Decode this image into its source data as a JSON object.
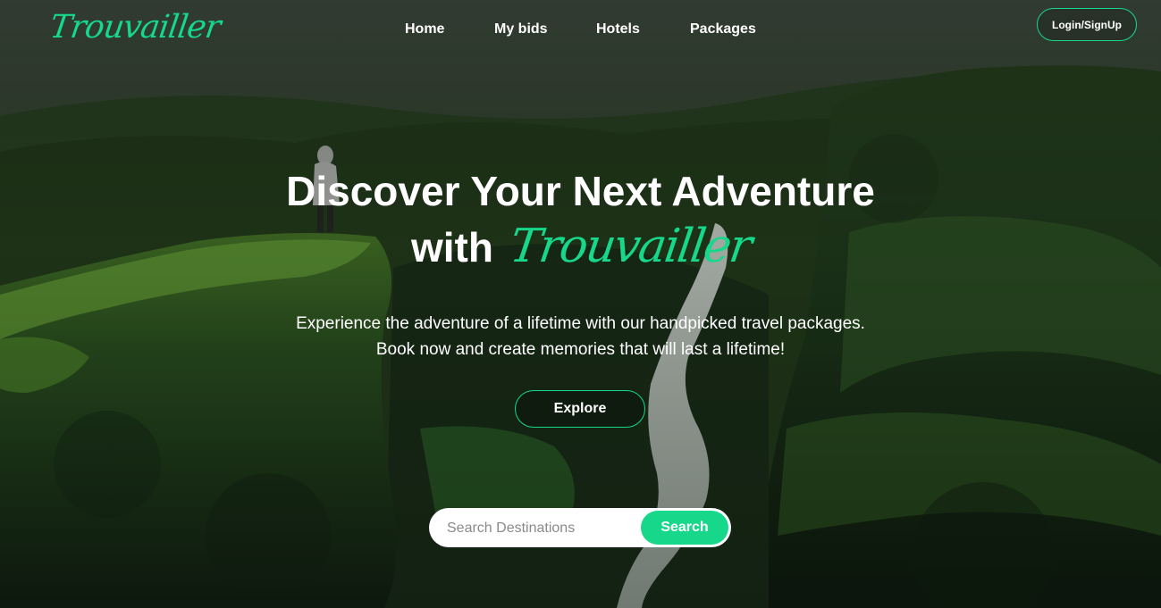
{
  "brand": {
    "logo_text": "Trouvailler",
    "accent_color": "#17d78a"
  },
  "nav": {
    "links": [
      {
        "label": "Home"
      },
      {
        "label": "My bids"
      },
      {
        "label": "Hotels"
      },
      {
        "label": "Packages"
      }
    ],
    "login_label": "Login/SignUp"
  },
  "hero": {
    "headline_line1": "Discover Your Next Adventure",
    "headline_with": "with",
    "headline_brand": "Trouvailler",
    "subtext_line1": "Experience the adventure of a lifetime with our handpicked travel packages.",
    "subtext_line2": "Book now and create memories that will last a lifetime!",
    "explore_label": "Explore"
  },
  "search": {
    "placeholder": "Search Destinations",
    "button_label": "Search"
  },
  "background": {
    "description_icon": "mountain-waterfall-photo"
  }
}
